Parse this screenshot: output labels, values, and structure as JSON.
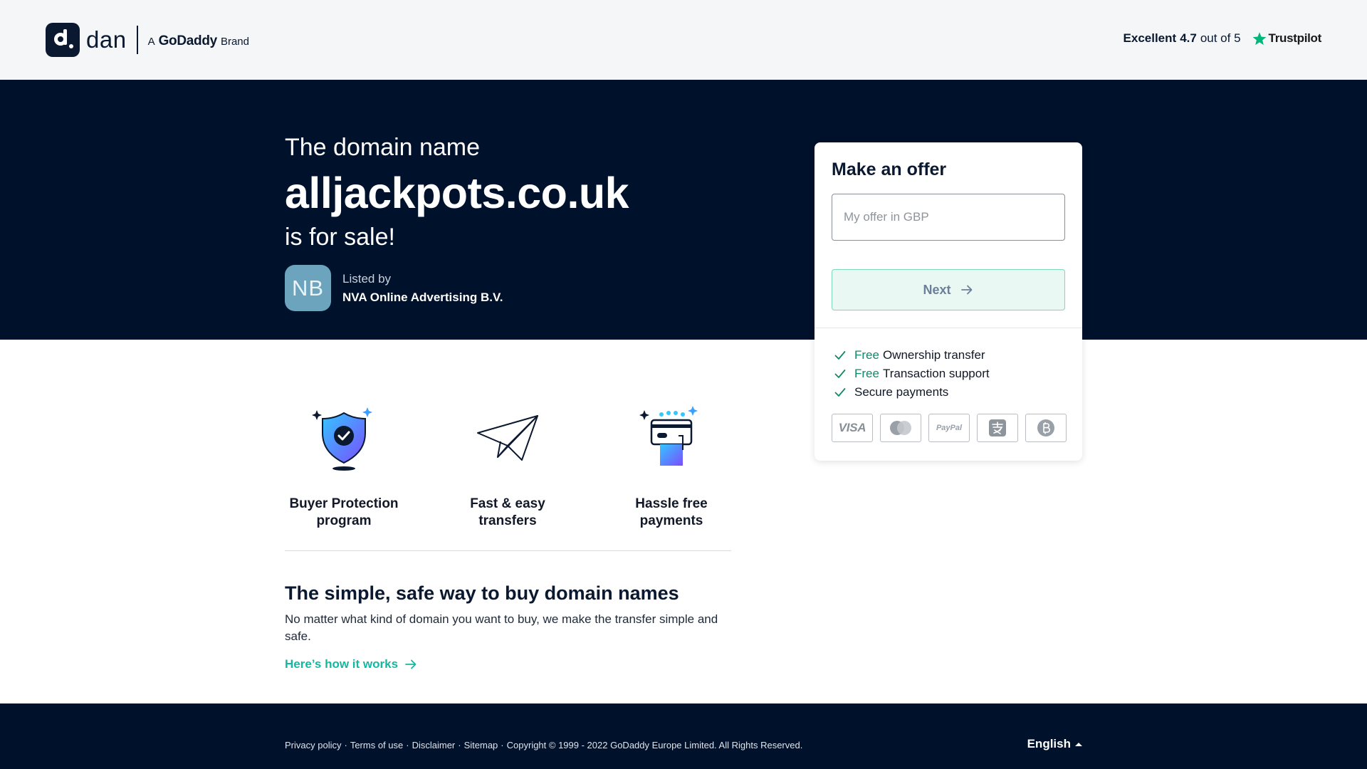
{
  "header": {
    "logo_text": "dan",
    "brand_prefix": "A",
    "brand_name": "GoDaddy",
    "brand_suffix": "Brand",
    "rating_word": "Excellent",
    "rating_score": "4.7",
    "rating_suffix": "out of 5",
    "trustpilot_label": "Trustpilot",
    "trustpilot_star_color": "#00b67a"
  },
  "hero": {
    "pre": "The domain name",
    "domain": "alljackpots.co.uk",
    "post": "is for sale!",
    "listed_by_label": "Listed by",
    "seller_initials": "NB",
    "seller_name": "NVA Online Advertising B.V."
  },
  "offer_card": {
    "title": "Make an offer",
    "input_placeholder": "My offer in GBP",
    "input_value": "",
    "next_label": "Next",
    "features": [
      {
        "free": "Free",
        "text": "Ownership transfer"
      },
      {
        "free": "Free",
        "text": "Transaction support"
      },
      {
        "free": "",
        "text": "Secure payments"
      }
    ],
    "payment_methods": [
      {
        "name": "visa-icon",
        "label": "VISA"
      },
      {
        "name": "mastercard-icon",
        "label": ""
      },
      {
        "name": "paypal-icon",
        "label": "PayPal"
      },
      {
        "name": "alipay-icon",
        "label": ""
      },
      {
        "name": "bitcoin-icon",
        "label": ""
      }
    ]
  },
  "perks": [
    {
      "icon": "shield-check-icon",
      "label_line1": "Buyer Protection",
      "label_line2": "program"
    },
    {
      "icon": "paper-plane-icon",
      "label_line1": "Fast & easy",
      "label_line2": "transfers"
    },
    {
      "icon": "card-hand-icon",
      "label_line1": "Hassle free",
      "label_line2": "payments"
    }
  ],
  "section": {
    "title": "The simple, safe way to buy domain names",
    "body": "No matter what kind of domain you want to buy, we make the transfer simple and safe.",
    "link": "Here’s how it works"
  },
  "footer": {
    "links": [
      "Privacy policy",
      "Terms of use",
      "Disclaimer",
      "Sitemap"
    ],
    "separator": "·",
    "copyright": "Copyright © 1999 - 2022 GoDaddy Europe Limited. All Rights Reserved.",
    "language": "English"
  },
  "colors": {
    "navy": "#00112c",
    "accent_teal": "#12b9a0",
    "free_green": "#0e8a6b",
    "button_border": "#7ed8bd",
    "avatar_bg": "#6ba4bc"
  }
}
